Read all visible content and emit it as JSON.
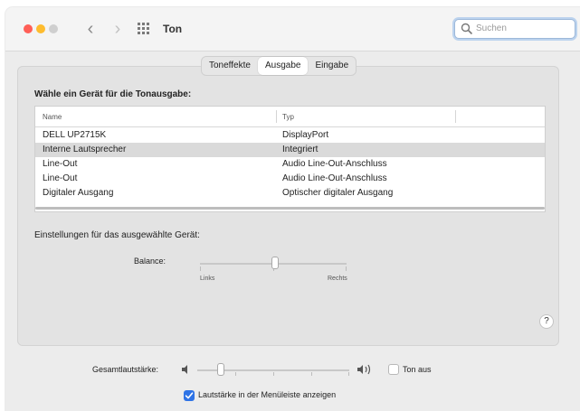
{
  "window": {
    "title": "Ton",
    "search_placeholder": "Suchen"
  },
  "tabs": [
    {
      "label": "Toneffekte",
      "active": false
    },
    {
      "label": "Ausgabe",
      "active": true
    },
    {
      "label": "Eingabe",
      "active": false
    }
  ],
  "output": {
    "heading": "Wähle ein Gerät für die Tonausgabe:",
    "columns": {
      "name": "Name",
      "type": "Typ"
    },
    "devices": [
      {
        "name": "DELL UP2715K",
        "type": "DisplayPort",
        "selected": false
      },
      {
        "name": "Interne Lautsprecher",
        "type": "Integriert",
        "selected": true
      },
      {
        "name": "Line-Out",
        "type": "Audio Line-Out-Anschluss",
        "selected": false
      },
      {
        "name": "Line-Out",
        "type": "Audio Line-Out-Anschluss",
        "selected": false
      },
      {
        "name": "Digitaler Ausgang",
        "type": "Optischer digitaler Ausgang",
        "selected": false
      }
    ],
    "settings_label": "Einstellungen für das ausgewählte Gerät:",
    "balance": {
      "label": "Balance:",
      "left_label": "Links",
      "right_label": "Rechts",
      "value": 0.5
    },
    "help": "?"
  },
  "bottom": {
    "volume_label": "Gesamtlautstärke:",
    "volume_value": 0.13,
    "mute_label": "Ton aus",
    "mute_checked": false,
    "menubar_label": "Lautstärke in der Menüleiste anzeigen",
    "menubar_checked": true
  },
  "colors": {
    "close": "#ff5f57",
    "minimize": "#febc2e",
    "accent": "#2e73e6"
  }
}
